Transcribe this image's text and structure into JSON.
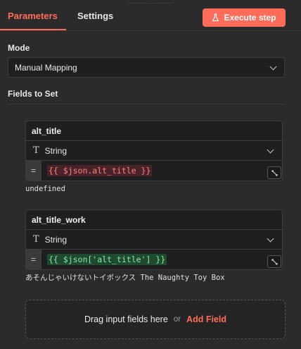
{
  "tabs": {
    "parameters": "Parameters",
    "settings": "Settings"
  },
  "execute_button": {
    "label": "Execute step",
    "icon": "flask-icon"
  },
  "mode": {
    "label": "Mode",
    "selected": "Manual Mapping"
  },
  "fields_to_set": {
    "label": "Fields to Set"
  },
  "fields": [
    {
      "name": "alt_title",
      "type": "String",
      "expression": "{{ $json.alt_title }}",
      "result": "undefined",
      "status": "error"
    },
    {
      "name": "alt_title_work",
      "type": "String",
      "expression": "{{ $json['alt_title'] }}",
      "result": "あそんじゃいけないトイボックス The Naughty Toy Box",
      "status": "ok"
    }
  ],
  "dropzone": {
    "text": "Drag input fields here",
    "or": "or",
    "add": "Add Field"
  },
  "colors": {
    "accent": "#ff6d5a",
    "background": "#2b2b2b",
    "card": "#1f1f1f"
  }
}
